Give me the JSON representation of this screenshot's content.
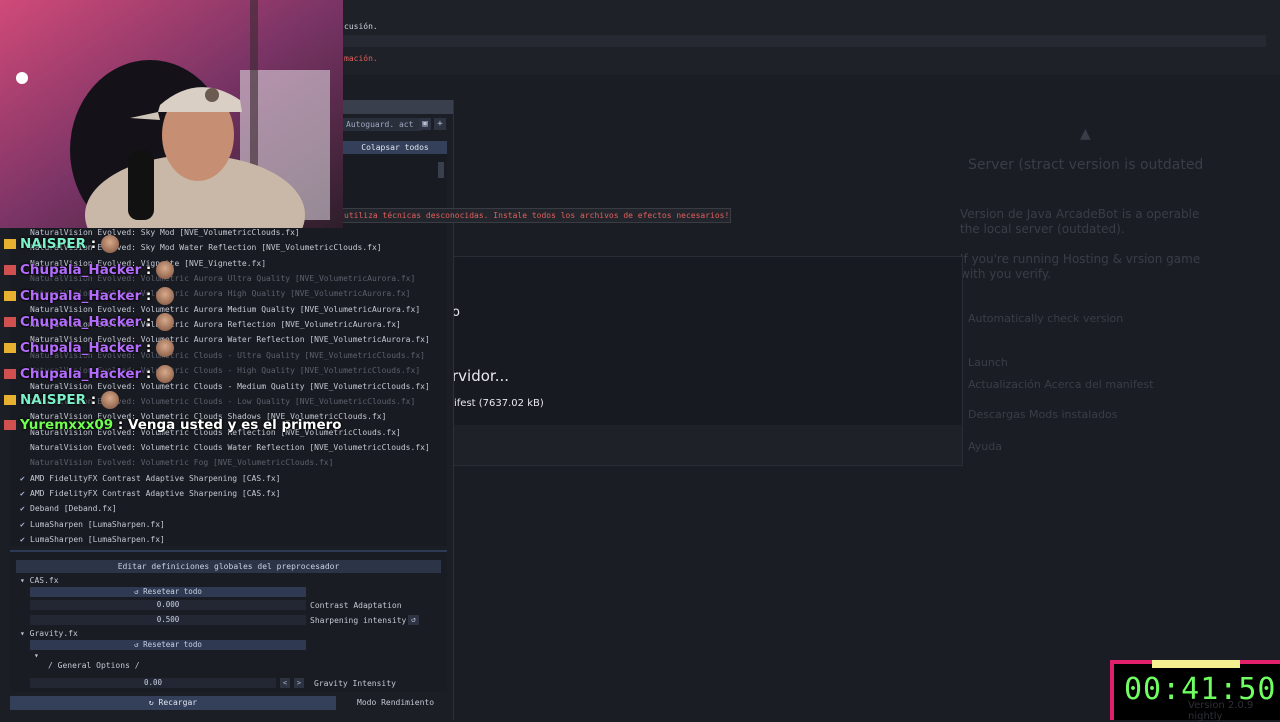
{
  "log": {
    "line1": "cusión.",
    "line3": "mación."
  },
  "server_dialog_bg": {
    "title": "Server (stract version is outdated",
    "p1a": "Version de Java ArcadeBot is a operable",
    "p1b": "the local server (outdated).",
    "p2a": "If you're running Hosting & vrsion game",
    "p2b": "with you verify.",
    "p3": "Automatically check version",
    "r1": "Launch",
    "r2": "Actualización    Acerca del manifest",
    "r3": "Descargas    Mods instalados",
    "r4": "Ayuda"
  },
  "loading": {
    "t1": "o",
    "t2": "rvidor...",
    "t3": "ifest (7637.02 kB)"
  },
  "reshade": {
    "preset_label": "Autoguard. act",
    "save_icon": "▣",
    "add_icon": "+",
    "collapse_all": "Colapsar todos",
    "warning": "utiliza técnicas desconocidas. Instale todos los archivos de efectos necesarios!",
    "effects": [
      {
        "label": "NaturalVision Evolved: Sky Mod [NVE_VolumetricClouds.fx]",
        "checked": false,
        "dim": false
      },
      {
        "label": "NaturalVision Evolved: Sky Mod Water Reflection [NVE_VolumetricClouds.fx]",
        "checked": false,
        "dim": false
      },
      {
        "label": "NaturalVision Evolved: Vignette [NVE_Vignette.fx]",
        "checked": false,
        "dim": false
      },
      {
        "label": "NaturalVision Evolved: Volumetric Aurora Ultra Quality [NVE_VolumetricAurora.fx]",
        "checked": false,
        "dim": true
      },
      {
        "label": "NaturalVision Evolved: Volumetric Aurora High Quality [NVE_VolumetricAurora.fx]",
        "checked": false,
        "dim": true
      },
      {
        "label": "NaturalVision Evolved: Volumetric Aurora Medium Quality [NVE_VolumetricAurora.fx]",
        "checked": false,
        "dim": false
      },
      {
        "label": "NaturalVision Evolved: Volumetric Aurora Reflection [NVE_VolumetricAurora.fx]",
        "checked": false,
        "dim": false
      },
      {
        "label": "NaturalVision Evolved: Volumetric Aurora Water Reflection [NVE_VolumetricAurora.fx]",
        "checked": false,
        "dim": false
      },
      {
        "label": "NaturalVision Evolved: Volumetric Clouds - Ultra Quality [NVE_VolumetricClouds.fx]",
        "checked": false,
        "dim": true
      },
      {
        "label": "NaturalVision Evolved: Volumetric Clouds - High Quality [NVE_VolumetricClouds.fx]",
        "checked": false,
        "dim": true
      },
      {
        "label": "NaturalVision Evolved: Volumetric Clouds - Medium Quality [NVE_VolumetricClouds.fx]",
        "checked": false,
        "dim": false
      },
      {
        "label": "NaturalVision Evolved: Volumetric Clouds - Low Quality [NVE_VolumetricClouds.fx]",
        "checked": false,
        "dim": true
      },
      {
        "label": "NaturalVision Evolved: Volumetric Clouds Shadows [NVE_VolumetricClouds.fx]",
        "checked": false,
        "dim": false
      },
      {
        "label": "NaturalVision Evolved: Volumetric Clouds Reflection [NVE_VolumetricClouds.fx]",
        "checked": false,
        "dim": false
      },
      {
        "label": "NaturalVision Evolved: Volumetric Clouds Water Reflection [NVE_VolumetricClouds.fx]",
        "checked": false,
        "dim": false
      },
      {
        "label": "NaturalVision Evolved: Volumetric Fog [NVE_VolumetricClouds.fx]",
        "checked": false,
        "dim": true
      },
      {
        "label": "AMD FidelityFX Contrast Adaptive Sharpening [CAS.fx]",
        "checked": true,
        "dim": false
      },
      {
        "label": "AMD FidelityFX Contrast Adaptive Sharpening [CAS.fx]",
        "checked": true,
        "dim": false
      },
      {
        "label": "Deband [Deband.fx]",
        "checked": true,
        "dim": false
      },
      {
        "label": "LumaSharpen [LumaSharpen.fx]",
        "checked": true,
        "dim": false
      },
      {
        "label": "LumaSharpen [LumaSharpen.fx]",
        "checked": true,
        "dim": false
      }
    ],
    "preproc_header": "Editar definiciones globales del preprocesador",
    "cas_section": "CAS.fx",
    "gravity_section": "Gravity.fx",
    "reset_all": "↺ Resetear todo",
    "contrast_value": "0.000",
    "contrast_label": "Contrast Adaptation",
    "sharpening_value": "0.500",
    "sharpening_label": "Sharpening intensity",
    "general_options": "/ General Options /",
    "gravity_value": "0.00",
    "gravity_label": "Gravity Intensity",
    "reload": "↻ Recargar",
    "perf_mode": "Modo Rendimiento"
  },
  "chat": [
    {
      "user": "NAISPER",
      "color": "#7cf0c8",
      "message": "",
      "emote": true
    },
    {
      "user": "Chupala_Hacker",
      "color": "#b46cff",
      "message": "",
      "emote": true
    },
    {
      "user": "Chupala_Hacker",
      "color": "#b46cff",
      "message": "",
      "emote": true
    },
    {
      "user": "Chupala_Hacker",
      "color": "#b46cff",
      "message": "",
      "emote": true
    },
    {
      "user": "Chupala_Hacker",
      "color": "#b46cff",
      "message": "",
      "emote": true
    },
    {
      "user": "Chupala_Hacker",
      "color": "#b46cff",
      "message": "",
      "emote": true
    },
    {
      "user": "NAISPER",
      "color": "#7cf0c8",
      "message": "",
      "emote": true
    },
    {
      "user": "Yuremxxx09",
      "color": "#70ff50",
      "message": "Venga usted y es el primero",
      "emote": false
    }
  ],
  "timer": {
    "value": "00:41:50",
    "accent": "#e0206a",
    "digits_color": "#70ff60"
  },
  "version_text": "Version 2.0.9 nightly"
}
